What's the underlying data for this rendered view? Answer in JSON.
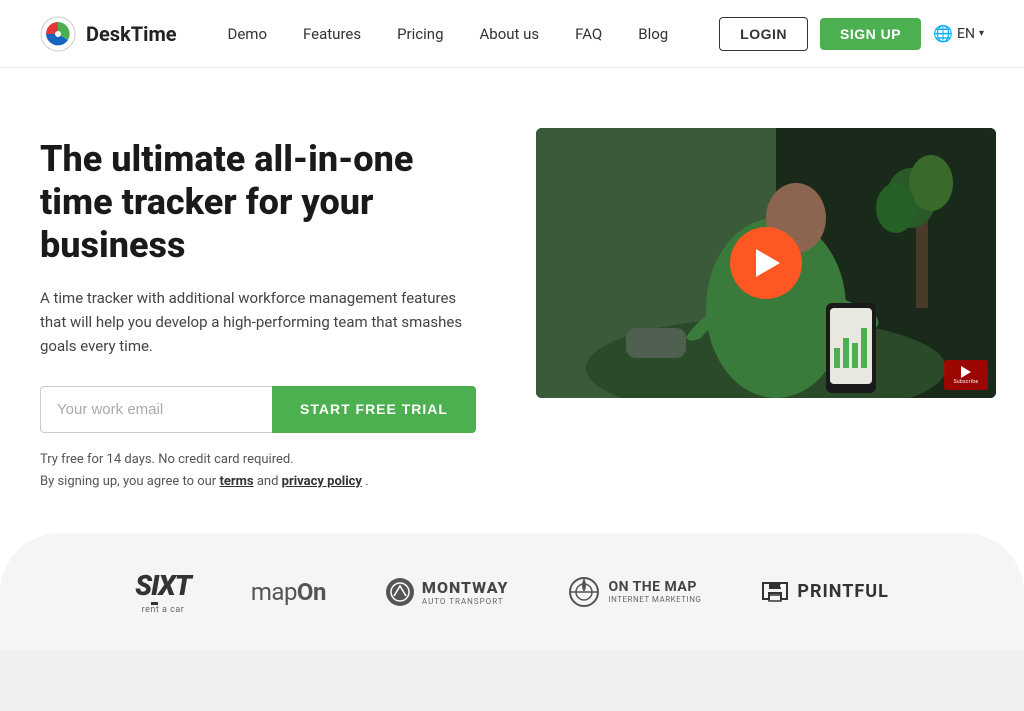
{
  "navbar": {
    "logo_text": "DeskTime",
    "nav_links": [
      {
        "label": "Demo",
        "id": "nav-demo"
      },
      {
        "label": "Features",
        "id": "nav-features"
      },
      {
        "label": "Pricing",
        "id": "nav-pricing"
      },
      {
        "label": "About us",
        "id": "nav-about"
      },
      {
        "label": "FAQ",
        "id": "nav-faq"
      },
      {
        "label": "Blog",
        "id": "nav-blog"
      }
    ],
    "login_label": "LOGIN",
    "signup_label": "SIGN UP",
    "lang_label": "EN"
  },
  "hero": {
    "title": "The ultimate all-in-one time tracker for your business",
    "subtitle": "A time tracker with additional workforce management features that will help you develop a high-performing team that smashes goals every time.",
    "email_placeholder": "Your work email",
    "cta_label": "START FREE TRIAL",
    "trial_note_line1": "Try free for 14 days. No credit card required.",
    "trial_note_line2": "By signing up, you agree to our",
    "terms_label": "terms",
    "and_label": " and ",
    "privacy_label": "privacy policy",
    "period": "."
  },
  "logos": [
    {
      "id": "sixt",
      "name": "SIXT",
      "sub": "rent a car"
    },
    {
      "id": "mapon",
      "name": "mapOn"
    },
    {
      "id": "montway",
      "name": "MONTWAY",
      "sub": "AUTO TRANSPORT"
    },
    {
      "id": "onthemap",
      "name": "ON THE MAP",
      "sub": "INTERNET MARKETING"
    },
    {
      "id": "printful",
      "name": "PRINTFUL"
    }
  ]
}
